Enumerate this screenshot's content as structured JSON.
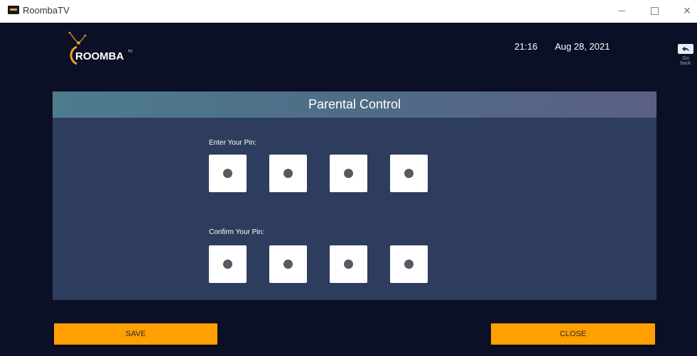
{
  "window": {
    "title": "RoombaTV",
    "controls": [
      "minimize",
      "maximize",
      "close"
    ],
    "close_glyph": "✕"
  },
  "header": {
    "logo_text": "ROOMBA",
    "logo_superscript": "TV",
    "time": "21:16",
    "date": "Aug 28, 2021",
    "go_back_label": "Go back"
  },
  "parental_control": {
    "title": "Parental Control",
    "enter_label": "Enter Your Pin:",
    "confirm_label": "Confirm Your Pin:",
    "enter_pin_digits": 4,
    "confirm_pin_digits": 4
  },
  "buttons": {
    "save": "SAVE",
    "close": "CLOSE"
  },
  "colors": {
    "background": "#0b1026",
    "panel": "#2e3d5d",
    "header_gradient_start": "#4e7c8d",
    "header_gradient_end": "#5b5f84",
    "accent": "#ffa000",
    "logo_orange": "#f0a020"
  }
}
